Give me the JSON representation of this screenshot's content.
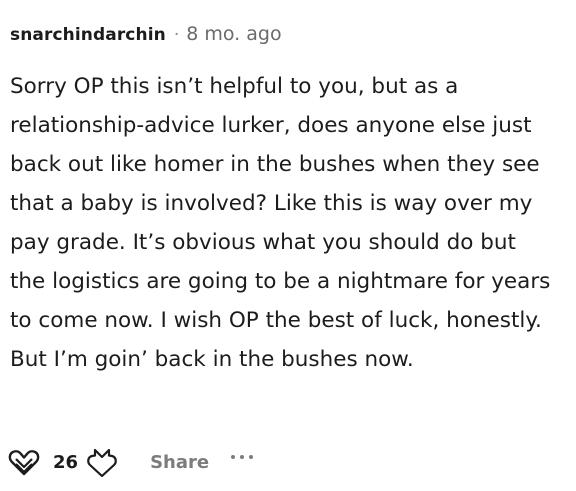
{
  "comment": {
    "author": "snarchindarchin",
    "separator": "·",
    "age": "8 mo. ago",
    "body": "Sorry OP this isn’t helpful to you, but as a relationship-advice lurker, does anyone else just back out like homer in the bushes when they see that a baby is involved? Like this is way over my pay grade. It’s obvious what you should do but the logistics are going to be a nightmare for years to come now. I wish OP the best of luck, honestly. But I’m goin’ back in the bushes now."
  },
  "actions": {
    "upvote_icon": "upvote-heart-icon",
    "score": "26",
    "downvote_icon": "downvote-icon",
    "share_label": "Share",
    "more_icon": "more-options-icon"
  },
  "colors": {
    "text": "#1c1c1c",
    "muted": "#7c7c7c",
    "background": "#ffffff"
  }
}
